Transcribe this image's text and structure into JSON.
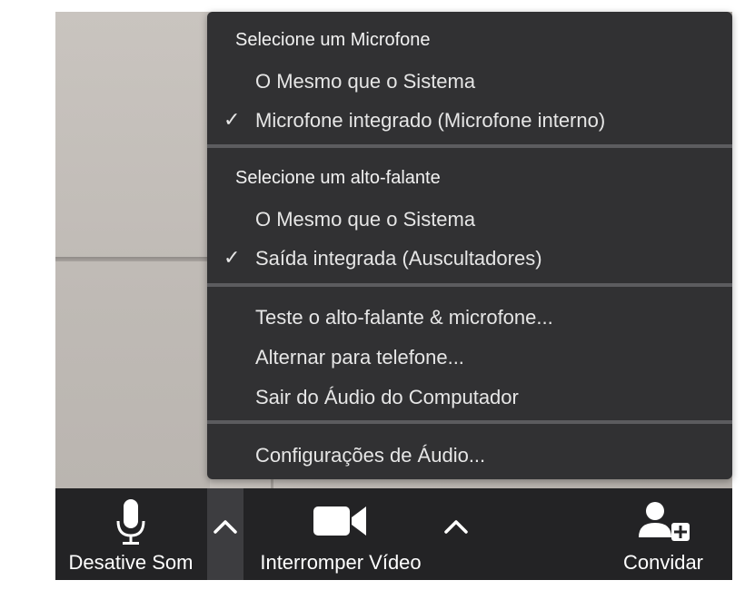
{
  "audio_menu": {
    "microphone_header": "Selecione um Microfone",
    "microphone_options": [
      {
        "label": "O Mesmo que o Sistema",
        "checked": false
      },
      {
        "label": "Microfone integrado (Microfone interno)",
        "checked": true
      }
    ],
    "speaker_header": "Selecione um alto-falante",
    "speaker_options": [
      {
        "label": "O Mesmo que o Sistema",
        "checked": false
      },
      {
        "label": "Saída integrada (Auscultadores)",
        "checked": true
      }
    ],
    "actions": [
      "Teste o alto-falante & microfone...",
      "Alternar para telefone...",
      "Sair do Áudio do Computador"
    ],
    "settings": "Configurações de Áudio...",
    "check_glyph": "✓"
  },
  "toolbar": {
    "mute_label": "Desative Som",
    "video_label": "Interromper Vídeo",
    "invite_label": "Convidar"
  },
  "colors": {
    "menu_bg": "#313133",
    "toolbar_bg": "#232325",
    "separator": "#5c5c5f"
  }
}
